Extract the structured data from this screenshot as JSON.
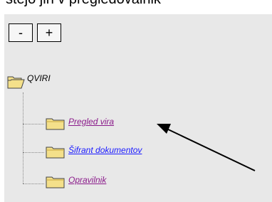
{
  "header": {
    "cut_text": "stejo jih v pregledovalnik"
  },
  "toolbar": {
    "collapse_label": "-",
    "expand_label": "+"
  },
  "tree": {
    "root_label": "QVIRI",
    "items": [
      {
        "label": "Pregled vira",
        "state": "visited"
      },
      {
        "label": "Šifrant dokumentov",
        "state": "unvisited"
      },
      {
        "label": "Opravilnik",
        "state": "visited"
      }
    ]
  },
  "colors": {
    "visited_link": "#8a1a8a",
    "link": "#1a1aff",
    "panel": "#e8e8e8",
    "folder": "#f4e08a"
  }
}
